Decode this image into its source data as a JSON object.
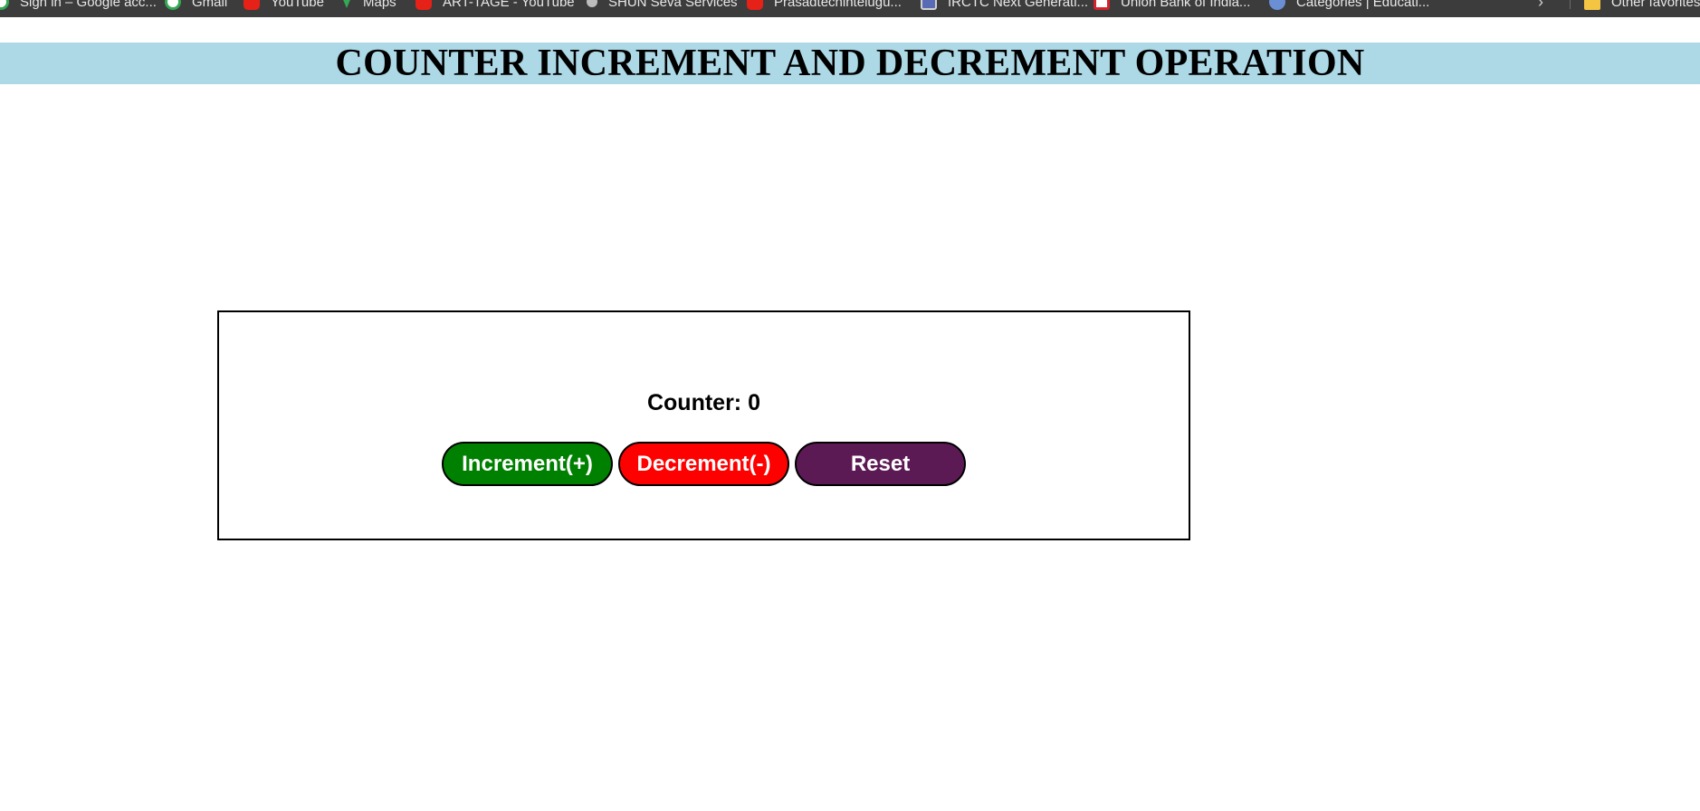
{
  "bookmarks": {
    "items": [
      {
        "label": "Sign in – Google acc...",
        "icon": "google-icon"
      },
      {
        "label": "Gmail",
        "icon": "gmail-icon"
      },
      {
        "label": "YouTube",
        "icon": "youtube-icon"
      },
      {
        "label": "Maps",
        "icon": "maps-icon"
      },
      {
        "label": "ART-TAGE - YouTube",
        "icon": "youtube-icon"
      },
      {
        "label": "SHUN Seva Services",
        "icon": "site-icon"
      },
      {
        "label": "Prasadtechintelugu...",
        "icon": "youtube-icon"
      },
      {
        "label": "IRCTC Next Generati...",
        "icon": "irctc-icon"
      },
      {
        "label": "Union Bank of India...",
        "icon": "union-bank-icon"
      },
      {
        "label": "Categories | Educati...",
        "icon": "gear-icon"
      }
    ],
    "other_label": "Other favorites",
    "overflow_icon": "chevron-right-icon"
  },
  "header": {
    "title": "COUNTER INCREMENT AND DECREMENT OPERATION",
    "background": "#add8e6"
  },
  "counter": {
    "label": "Counter:",
    "value": "0"
  },
  "buttons": {
    "increment_label": "Increment(+)",
    "decrement_label": "Decrement(-)",
    "reset_label": "Reset",
    "increment_color": "#008000",
    "decrement_color": "#ff0000",
    "reset_color": "#5c1a55"
  }
}
